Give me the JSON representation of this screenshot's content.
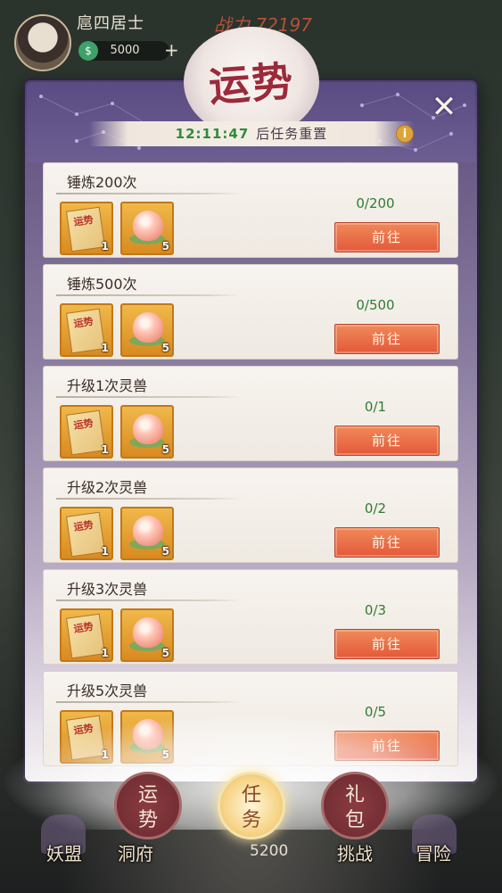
{
  "hud": {
    "player_name": "扈四居士",
    "combat_power": "战力 72197",
    "currency": "5000",
    "currency_icon": "$",
    "plus": "+"
  },
  "panel": {
    "title": "运势",
    "close_icon": "✕",
    "timer": {
      "time": "12:11:47",
      "label": "后任务重置"
    },
    "info_icon": "i"
  },
  "tasks": [
    {
      "name": "锤炼200次",
      "progress": "0/200",
      "button": "前往",
      "rewards": [
        {
          "icon": "fortune-scroll-icon",
          "label": "运势",
          "count": "1"
        },
        {
          "icon": "peach-icon",
          "count": "5"
        }
      ]
    },
    {
      "name": "锤炼500次",
      "progress": "0/500",
      "button": "前往",
      "rewards": [
        {
          "icon": "fortune-scroll-icon",
          "label": "运势",
          "count": "1"
        },
        {
          "icon": "peach-icon",
          "count": "5"
        }
      ]
    },
    {
      "name": "升级1次灵兽",
      "progress": "0/1",
      "button": "前往",
      "rewards": [
        {
          "icon": "fortune-scroll-icon",
          "label": "运势",
          "count": "1"
        },
        {
          "icon": "peach-icon",
          "count": "5"
        }
      ]
    },
    {
      "name": "升级2次灵兽",
      "progress": "0/2",
      "button": "前往",
      "rewards": [
        {
          "icon": "fortune-scroll-icon",
          "label": "运势",
          "count": "1"
        },
        {
          "icon": "peach-icon",
          "count": "5"
        }
      ]
    },
    {
      "name": "升级3次灵兽",
      "progress": "0/3",
      "button": "前往",
      "rewards": [
        {
          "icon": "fortune-scroll-icon",
          "label": "运势",
          "count": "1"
        },
        {
          "icon": "peach-icon",
          "count": "5"
        }
      ]
    },
    {
      "name": "升级5次灵兽",
      "progress": "0/5",
      "button": "前往",
      "rewards": [
        {
          "icon": "fortune-scroll-icon",
          "label": "运势",
          "count": "1"
        },
        {
          "icon": "peach-icon",
          "count": "5"
        }
      ]
    }
  ],
  "tabs": [
    {
      "line1": "运",
      "line2": "势"
    },
    {
      "line1": "任",
      "line2": "务"
    },
    {
      "line1": "礼",
      "line2": "包"
    }
  ],
  "bottom_nav": {
    "items": [
      "妖盟",
      "洞府",
      "挑战",
      "冒险"
    ],
    "coin": "5200"
  },
  "colors": {
    "accent_button": "#e3583a",
    "progress_green": "#2e7d32",
    "title_red": "#9c2a3a"
  }
}
